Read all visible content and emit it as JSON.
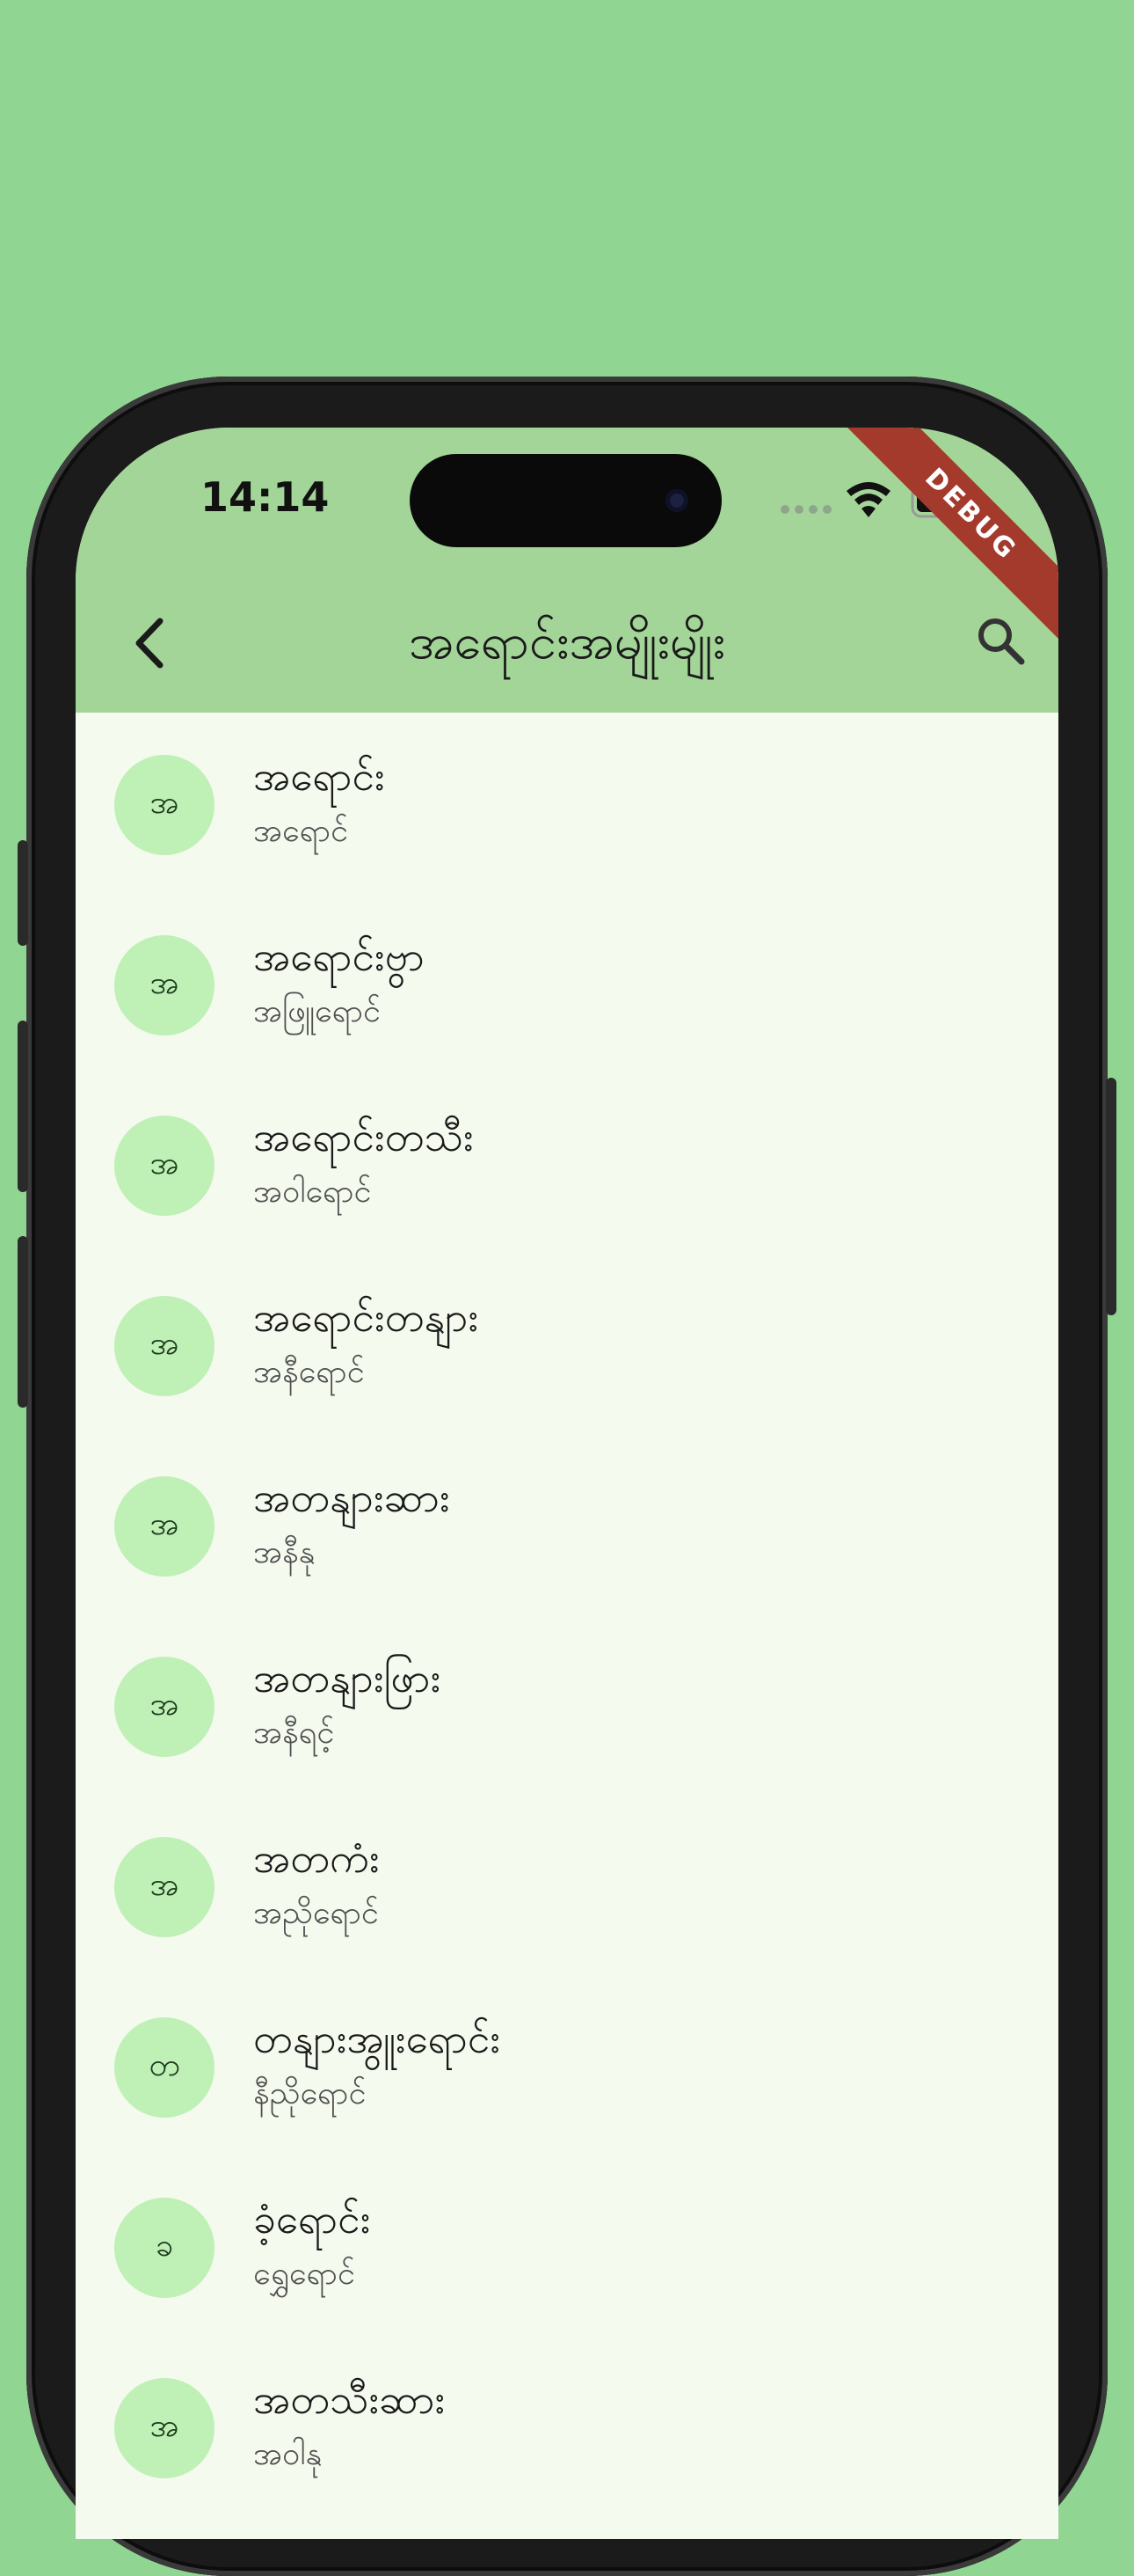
{
  "status_bar": {
    "time": "14:14"
  },
  "debug_banner": "DEBUG",
  "app_bar": {
    "title": "အရောင်းအမျိုးမျိုး"
  },
  "colors": {
    "background": "#90d592",
    "app_bar": "#a4d598",
    "list_bg": "#f5faef",
    "avatar": "#bff0b5",
    "debug": "#a33a2c"
  },
  "icons": {
    "back": "chevron-left-icon",
    "search": "search-icon"
  },
  "items": [
    {
      "initial": "အ",
      "title": "အရောင်း",
      "subtitle": "အရောင်"
    },
    {
      "initial": "အ",
      "title": "အရောင်းဗွာ",
      "subtitle": "အဖြူရောင်"
    },
    {
      "initial": "အ",
      "title": "အရောင်းတသီး",
      "subtitle": "အဝါရောင်"
    },
    {
      "initial": "အ",
      "title": "အရောင်းတနျား",
      "subtitle": "အနီရောင်"
    },
    {
      "initial": "အ",
      "title": "အတနျားဆား",
      "subtitle": "အနီနု"
    },
    {
      "initial": "အ",
      "title": "အတနျားဖြား",
      "subtitle": "အနီရင့်"
    },
    {
      "initial": "အ",
      "title": "အတကံး",
      "subtitle": "အညိုရောင်"
    },
    {
      "initial": "တ",
      "title": "တနျားအွူးရောင်း",
      "subtitle": "နီညိုရောင်"
    },
    {
      "initial": "ခ",
      "title": "ခံ့ရောင်း",
      "subtitle": "ရွှေရောင်"
    },
    {
      "initial": "အ",
      "title": "အတသီးဆား",
      "subtitle": "အဝါနု"
    }
  ]
}
